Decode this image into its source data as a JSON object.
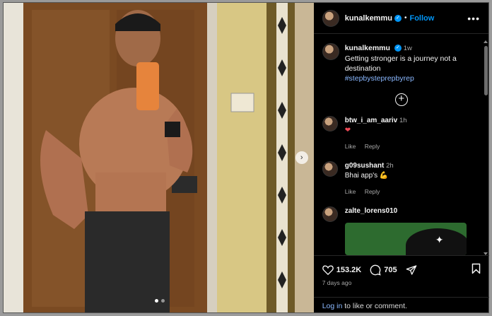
{
  "post": {
    "username": "kunalkemmu",
    "follow_label": "Follow",
    "more_label": "•••",
    "caption_username": "kunalkemmu",
    "caption_time": "1w",
    "caption_text": "Getting stronger is a journey not a destination",
    "caption_hashtag": "#stepbysteprepbyrep",
    "comments": [
      {
        "username": "btw_i_am_aariv",
        "time": "1h",
        "text": "❤",
        "like": "Like",
        "reply": "Reply"
      },
      {
        "username": "g09sushant",
        "time": "2h",
        "text": "Bhai app's",
        "emoji": "💪",
        "like": "Like",
        "reply": "Reply"
      },
      {
        "username": "zalte_lorens010",
        "time": ""
      }
    ],
    "likes": "153.2K",
    "comment_count": "705",
    "posted": "7 days ago",
    "login_link": "Log in",
    "login_rest": " to like or comment."
  },
  "carousel": {
    "current": 1,
    "total": 2
  },
  "colors": {
    "accent": "#0095f6",
    "background": "#000000",
    "like": "#ed4956"
  },
  "icons": [
    "verified-icon",
    "more-icon",
    "add-comment-icon",
    "heart-icon",
    "comment-icon",
    "share-icon",
    "bookmark-icon",
    "next-arrow-icon"
  ]
}
